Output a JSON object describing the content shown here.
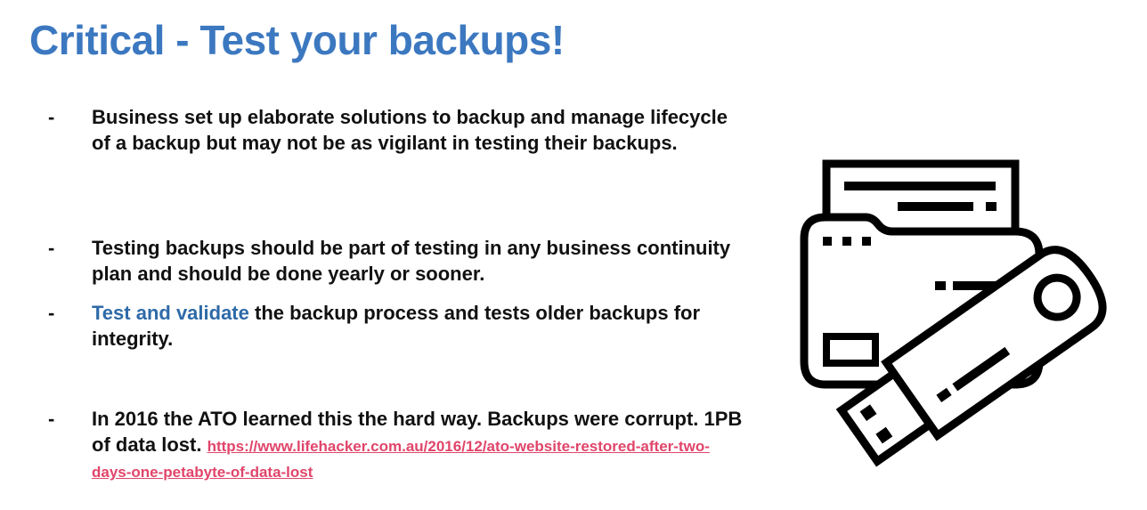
{
  "title": "Critical - Test your backups!",
  "bullets": [
    {
      "dash": "-",
      "text": "Business set up elaborate solutions to backup and manage lifecycle of a backup but may not be as vigilant in testing their backups."
    },
    {
      "dash": "-",
      "text": "Testing backups should be part of testing in any business continuity plan and should be done yearly or sooner."
    },
    {
      "dash": "-",
      "highlight": "Test and validate",
      "text": " the backup process and tests older backups for integrity."
    },
    {
      "dash": "-",
      "text": "In 2016 the ATO learned this the hard way. Backups were corrupt. 1PB of data lost. ",
      "link": "https://www.lifehacker.com.au/2016/12/ato-website-restored-after-two-days-one-petabyte-of-data-lost"
    }
  ],
  "illustration": {
    "icon": "usb-drive-and-folder-icon",
    "color": "#000000"
  },
  "colors": {
    "title": "#3c78c0",
    "highlight": "#2e6aa8",
    "link": "#e0456a",
    "text": "#111111"
  }
}
